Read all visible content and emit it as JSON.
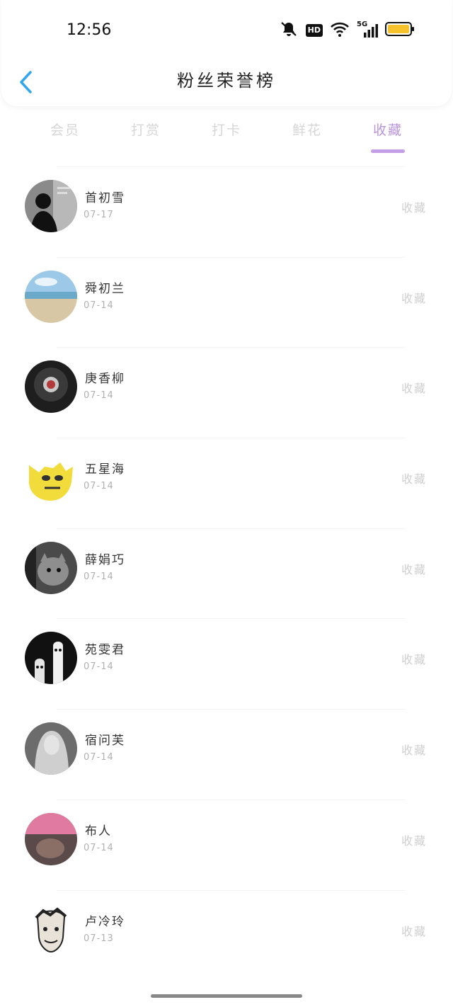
{
  "status": {
    "time": "12:56",
    "network_label": "5G",
    "hd_label": "HD",
    "icons": [
      "mute-bell-icon",
      "hd-icon",
      "wifi-icon",
      "signal-5g-icon",
      "battery-icon"
    ],
    "battery_color": "#f5c22b"
  },
  "header": {
    "title": "粉丝荣誉榜",
    "back_icon": "chevron-left-icon",
    "back_color": "#2ea7f0"
  },
  "tabs": [
    {
      "label": "会员"
    },
    {
      "label": "打赏"
    },
    {
      "label": "打卡"
    },
    {
      "label": "鲜花"
    },
    {
      "label": "收藏",
      "active": true
    }
  ],
  "accent_color": "#c59ee8",
  "fans": [
    {
      "name": "首初雪",
      "date": "07-17",
      "action": "收藏"
    },
    {
      "name": "舜初兰",
      "date": "07-14",
      "action": "收藏"
    },
    {
      "name": "庚香柳",
      "date": "07-14",
      "action": "收藏"
    },
    {
      "name": "五星海",
      "date": "07-14",
      "action": "收藏"
    },
    {
      "name": "薛娟巧",
      "date": "07-14",
      "action": "收藏"
    },
    {
      "name": "苑雯君",
      "date": "07-14",
      "action": "收藏"
    },
    {
      "name": "宿问芙",
      "date": "07-14",
      "action": "收藏"
    },
    {
      "name": "布人",
      "date": "07-14",
      "action": "收藏"
    },
    {
      "name": "卢冷玲",
      "date": "07-13",
      "action": "收藏"
    }
  ]
}
